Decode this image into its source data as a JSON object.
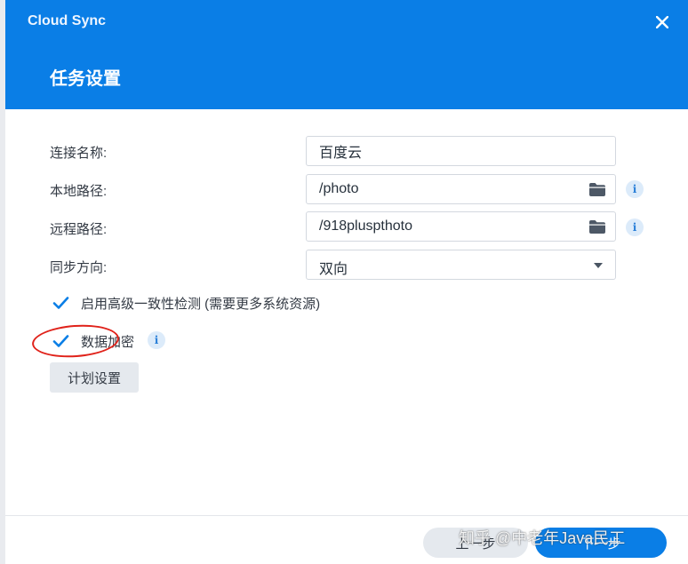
{
  "window": {
    "app_title": "Cloud Sync",
    "page_title": "任务设置"
  },
  "form": {
    "connection_name": {
      "label": "连接名称:",
      "value": "百度云"
    },
    "local_path": {
      "label": "本地路径:",
      "value": "/photo"
    },
    "remote_path": {
      "label": "远程路径:",
      "value": "/918pluspthoto"
    },
    "sync_direction": {
      "label": "同步方向:",
      "value": "双向"
    }
  },
  "options": {
    "consistency_check": {
      "label": "启用高级一致性检测 (需要更多系统资源)",
      "checked": true
    },
    "data_encryption": {
      "label": "数据加密",
      "checked": true
    }
  },
  "buttons": {
    "schedule": "计划设置",
    "prev": "上一步",
    "next": "下一步"
  },
  "icons": {
    "close": "close-icon",
    "folder": "folder-icon",
    "info": "info-icon",
    "info_glyph": "i",
    "check": "checkmark-icon",
    "caret": "chevron-down-icon"
  },
  "colors": {
    "header": "#0a7ee6",
    "accent": "#0a7ee6",
    "highlight": "#e0221a"
  },
  "watermark": "知乎 @中老年Java民工"
}
